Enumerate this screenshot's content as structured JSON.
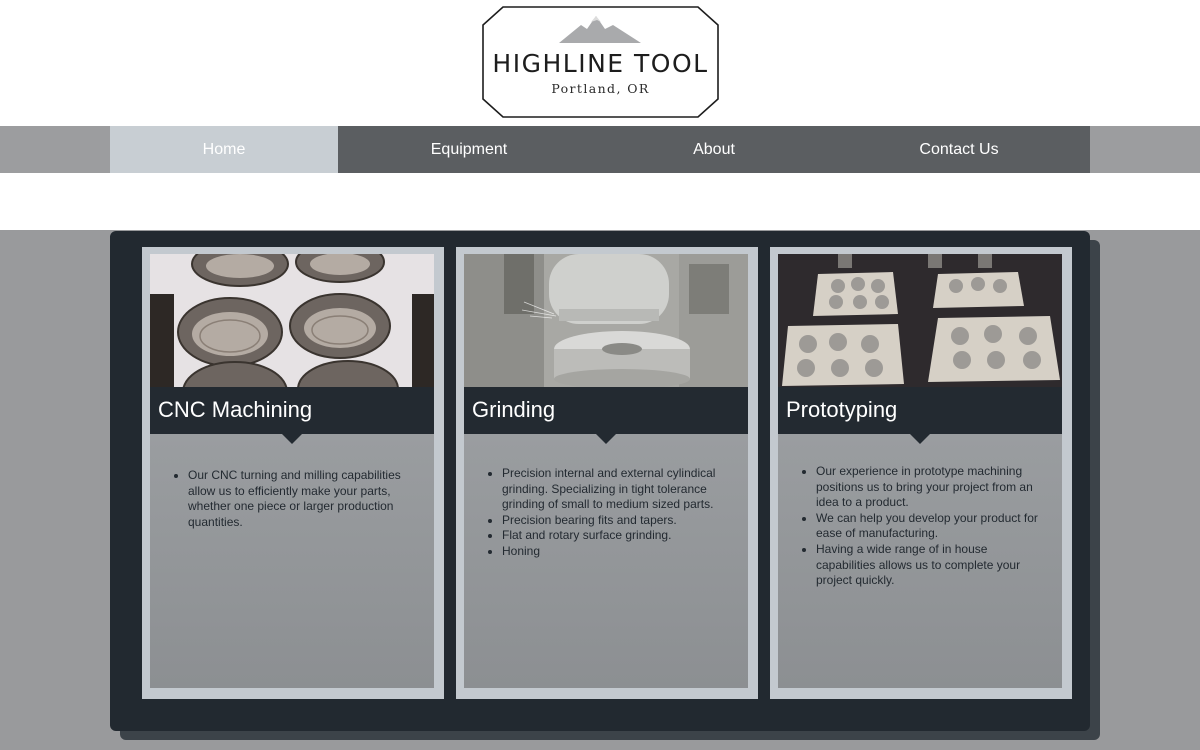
{
  "logo": {
    "title": "HIGHLINE TOOL",
    "subtitle": "Portland, OR"
  },
  "nav": {
    "items": [
      {
        "label": "Home",
        "active": true
      },
      {
        "label": "Equipment",
        "active": false
      },
      {
        "label": "About",
        "active": false
      },
      {
        "label": "Contact Us",
        "active": false
      }
    ]
  },
  "cards": [
    {
      "title": "CNC Machining",
      "image": "threaded-metal-cups-photo",
      "bullets": [
        "Our CNC turning and milling capabilities allow us to efficiently make your parts, whether one piece or larger production quantities."
      ]
    },
    {
      "title": "Grinding",
      "image": "grinding-wheel-photo",
      "bullets": [
        "Precision internal and external cylindical grinding.  Specializing in tight tolerance grinding of small to medium sized parts.",
        "Precision bearing fits and tapers.",
        "Flat and rotary surface grinding.",
        "Honing"
      ]
    },
    {
      "title": "Prototyping",
      "image": "prototype-parts-trays-photo",
      "bullets": [
        "Our experience in prototype machining positions us to bring your project from an idea to a product.",
        "We can help you develop your product for ease of manufacturing.",
        "Having a wide range of in house capabilities allows us to complete your project quickly."
      ]
    }
  ],
  "colors": {
    "nav_bg": "#5b5e61",
    "nav_active": "#c8ced3",
    "panel_bg": "#222930",
    "card_frame": "#c3c9cf",
    "content_bg": "#999a9c"
  }
}
